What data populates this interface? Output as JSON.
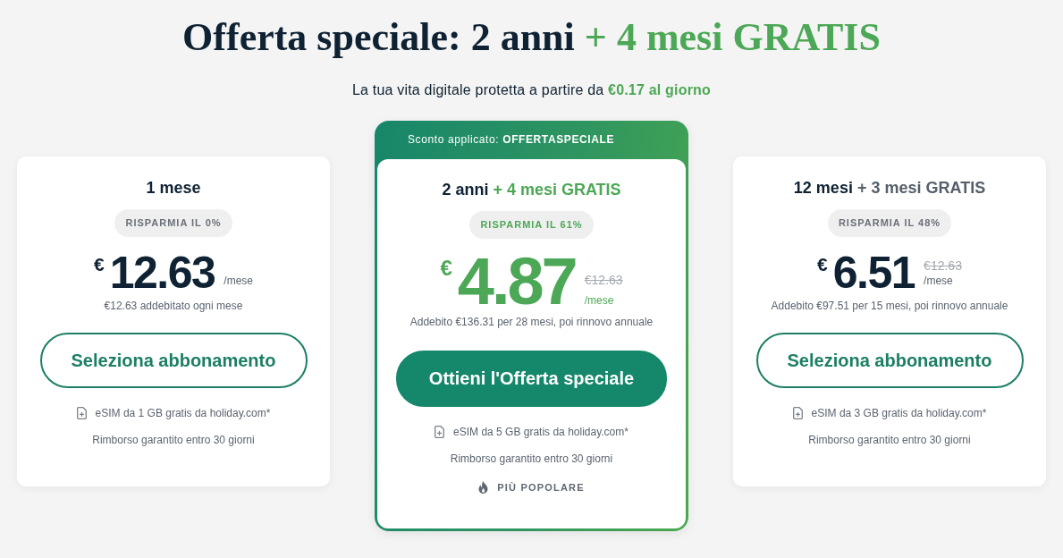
{
  "header": {
    "title": "Offerta speciale: 2 anni",
    "title_highlight": "+ 4 mesi GRATIS",
    "subtitle": "La tua vita digitale protetta a partire da **€0.17 al giorno**"
  },
  "plans": [
    {
      "featured": false,
      "title": "1 mese",
      "savings": "RISPARMIA IL 0%",
      "currency": "€",
      "price": "12.63",
      "unit": "/mese",
      "billing": "€12.63 addebitato ogni mese",
      "button": "Seleziona abbonamento",
      "features": [
        {
          "kind": "esim",
          "text": "eSIM da 1 GB gratis da holiday.com*"
        },
        {
          "kind": "text",
          "text": "Rimborso garantito entro 30 giorni"
        }
      ]
    },
    {
      "featured": true,
      "banner": "Sconto applicato: **OFFERTASPECIALE**",
      "title": "2 anni",
      "title_bonus": "+ 4 mesi GRATIS",
      "savings": "RISPARMIA IL 61%",
      "currency": "€",
      "price": "4.87",
      "old_price": "€12.63",
      "unit": "/mese",
      "billing": "Addebito €136.31 per 28 mesi, poi rinnovo annuale",
      "button": "Ottieni l'Offerta speciale",
      "features": [
        {
          "kind": "esim",
          "text": "eSIM da 5 GB gratis da holiday.com*"
        },
        {
          "kind": "text",
          "text": "Rimborso garantito entro 30 giorni"
        }
      ],
      "popular": "PIÙ POPOLARE"
    },
    {
      "featured": false,
      "title": "12 mesi",
      "title_bonus": "+ 3 mesi GRATIS",
      "savings": "RISPARMIA IL 48%",
      "currency": "€",
      "price": "6.51",
      "old_price": "€12.63",
      "unit": "/mese",
      "billing": "Addebito €97.51 per 15 mesi, poi rinnovo annuale",
      "button": "Seleziona abbonamento",
      "features": [
        {
          "kind": "esim",
          "text": "eSIM da 3 GB gratis da holiday.com*"
        },
        {
          "kind": "text",
          "text": "Rimborso garantito entro 30 giorni"
        }
      ]
    }
  ]
}
